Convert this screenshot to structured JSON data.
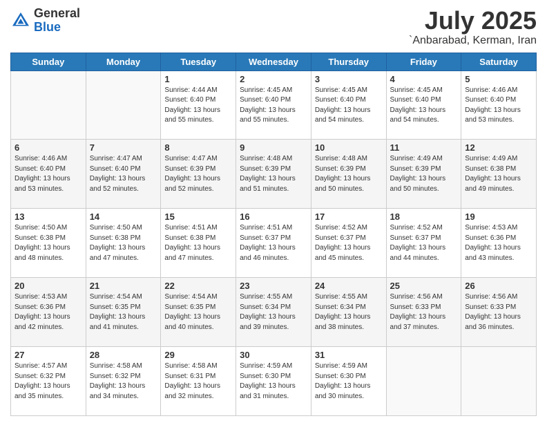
{
  "header": {
    "logo_line1": "General",
    "logo_line2": "Blue",
    "month": "July 2025",
    "location": "`Anbarabad, Kerman, Iran"
  },
  "weekdays": [
    "Sunday",
    "Monday",
    "Tuesday",
    "Wednesday",
    "Thursday",
    "Friday",
    "Saturday"
  ],
  "weeks": [
    [
      {
        "day": "",
        "sunrise": "",
        "sunset": "",
        "daylight": ""
      },
      {
        "day": "",
        "sunrise": "",
        "sunset": "",
        "daylight": ""
      },
      {
        "day": "1",
        "sunrise": "Sunrise: 4:44 AM",
        "sunset": "Sunset: 6:40 PM",
        "daylight": "Daylight: 13 hours and 55 minutes."
      },
      {
        "day": "2",
        "sunrise": "Sunrise: 4:45 AM",
        "sunset": "Sunset: 6:40 PM",
        "daylight": "Daylight: 13 hours and 55 minutes."
      },
      {
        "day": "3",
        "sunrise": "Sunrise: 4:45 AM",
        "sunset": "Sunset: 6:40 PM",
        "daylight": "Daylight: 13 hours and 54 minutes."
      },
      {
        "day": "4",
        "sunrise": "Sunrise: 4:45 AM",
        "sunset": "Sunset: 6:40 PM",
        "daylight": "Daylight: 13 hours and 54 minutes."
      },
      {
        "day": "5",
        "sunrise": "Sunrise: 4:46 AM",
        "sunset": "Sunset: 6:40 PM",
        "daylight": "Daylight: 13 hours and 53 minutes."
      }
    ],
    [
      {
        "day": "6",
        "sunrise": "Sunrise: 4:46 AM",
        "sunset": "Sunset: 6:40 PM",
        "daylight": "Daylight: 13 hours and 53 minutes."
      },
      {
        "day": "7",
        "sunrise": "Sunrise: 4:47 AM",
        "sunset": "Sunset: 6:40 PM",
        "daylight": "Daylight: 13 hours and 52 minutes."
      },
      {
        "day": "8",
        "sunrise": "Sunrise: 4:47 AM",
        "sunset": "Sunset: 6:39 PM",
        "daylight": "Daylight: 13 hours and 52 minutes."
      },
      {
        "day": "9",
        "sunrise": "Sunrise: 4:48 AM",
        "sunset": "Sunset: 6:39 PM",
        "daylight": "Daylight: 13 hours and 51 minutes."
      },
      {
        "day": "10",
        "sunrise": "Sunrise: 4:48 AM",
        "sunset": "Sunset: 6:39 PM",
        "daylight": "Daylight: 13 hours and 50 minutes."
      },
      {
        "day": "11",
        "sunrise": "Sunrise: 4:49 AM",
        "sunset": "Sunset: 6:39 PM",
        "daylight": "Daylight: 13 hours and 50 minutes."
      },
      {
        "day": "12",
        "sunrise": "Sunrise: 4:49 AM",
        "sunset": "Sunset: 6:38 PM",
        "daylight": "Daylight: 13 hours and 49 minutes."
      }
    ],
    [
      {
        "day": "13",
        "sunrise": "Sunrise: 4:50 AM",
        "sunset": "Sunset: 6:38 PM",
        "daylight": "Daylight: 13 hours and 48 minutes."
      },
      {
        "day": "14",
        "sunrise": "Sunrise: 4:50 AM",
        "sunset": "Sunset: 6:38 PM",
        "daylight": "Daylight: 13 hours and 47 minutes."
      },
      {
        "day": "15",
        "sunrise": "Sunrise: 4:51 AM",
        "sunset": "Sunset: 6:38 PM",
        "daylight": "Daylight: 13 hours and 47 minutes."
      },
      {
        "day": "16",
        "sunrise": "Sunrise: 4:51 AM",
        "sunset": "Sunset: 6:37 PM",
        "daylight": "Daylight: 13 hours and 46 minutes."
      },
      {
        "day": "17",
        "sunrise": "Sunrise: 4:52 AM",
        "sunset": "Sunset: 6:37 PM",
        "daylight": "Daylight: 13 hours and 45 minutes."
      },
      {
        "day": "18",
        "sunrise": "Sunrise: 4:52 AM",
        "sunset": "Sunset: 6:37 PM",
        "daylight": "Daylight: 13 hours and 44 minutes."
      },
      {
        "day": "19",
        "sunrise": "Sunrise: 4:53 AM",
        "sunset": "Sunset: 6:36 PM",
        "daylight": "Daylight: 13 hours and 43 minutes."
      }
    ],
    [
      {
        "day": "20",
        "sunrise": "Sunrise: 4:53 AM",
        "sunset": "Sunset: 6:36 PM",
        "daylight": "Daylight: 13 hours and 42 minutes."
      },
      {
        "day": "21",
        "sunrise": "Sunrise: 4:54 AM",
        "sunset": "Sunset: 6:35 PM",
        "daylight": "Daylight: 13 hours and 41 minutes."
      },
      {
        "day": "22",
        "sunrise": "Sunrise: 4:54 AM",
        "sunset": "Sunset: 6:35 PM",
        "daylight": "Daylight: 13 hours and 40 minutes."
      },
      {
        "day": "23",
        "sunrise": "Sunrise: 4:55 AM",
        "sunset": "Sunset: 6:34 PM",
        "daylight": "Daylight: 13 hours and 39 minutes."
      },
      {
        "day": "24",
        "sunrise": "Sunrise: 4:55 AM",
        "sunset": "Sunset: 6:34 PM",
        "daylight": "Daylight: 13 hours and 38 minutes."
      },
      {
        "day": "25",
        "sunrise": "Sunrise: 4:56 AM",
        "sunset": "Sunset: 6:33 PM",
        "daylight": "Daylight: 13 hours and 37 minutes."
      },
      {
        "day": "26",
        "sunrise": "Sunrise: 4:56 AM",
        "sunset": "Sunset: 6:33 PM",
        "daylight": "Daylight: 13 hours and 36 minutes."
      }
    ],
    [
      {
        "day": "27",
        "sunrise": "Sunrise: 4:57 AM",
        "sunset": "Sunset: 6:32 PM",
        "daylight": "Daylight: 13 hours and 35 minutes."
      },
      {
        "day": "28",
        "sunrise": "Sunrise: 4:58 AM",
        "sunset": "Sunset: 6:32 PM",
        "daylight": "Daylight: 13 hours and 34 minutes."
      },
      {
        "day": "29",
        "sunrise": "Sunrise: 4:58 AM",
        "sunset": "Sunset: 6:31 PM",
        "daylight": "Daylight: 13 hours and 32 minutes."
      },
      {
        "day": "30",
        "sunrise": "Sunrise: 4:59 AM",
        "sunset": "Sunset: 6:30 PM",
        "daylight": "Daylight: 13 hours and 31 minutes."
      },
      {
        "day": "31",
        "sunrise": "Sunrise: 4:59 AM",
        "sunset": "Sunset: 6:30 PM",
        "daylight": "Daylight: 13 hours and 30 minutes."
      },
      {
        "day": "",
        "sunrise": "",
        "sunset": "",
        "daylight": ""
      },
      {
        "day": "",
        "sunrise": "",
        "sunset": "",
        "daylight": ""
      }
    ]
  ]
}
